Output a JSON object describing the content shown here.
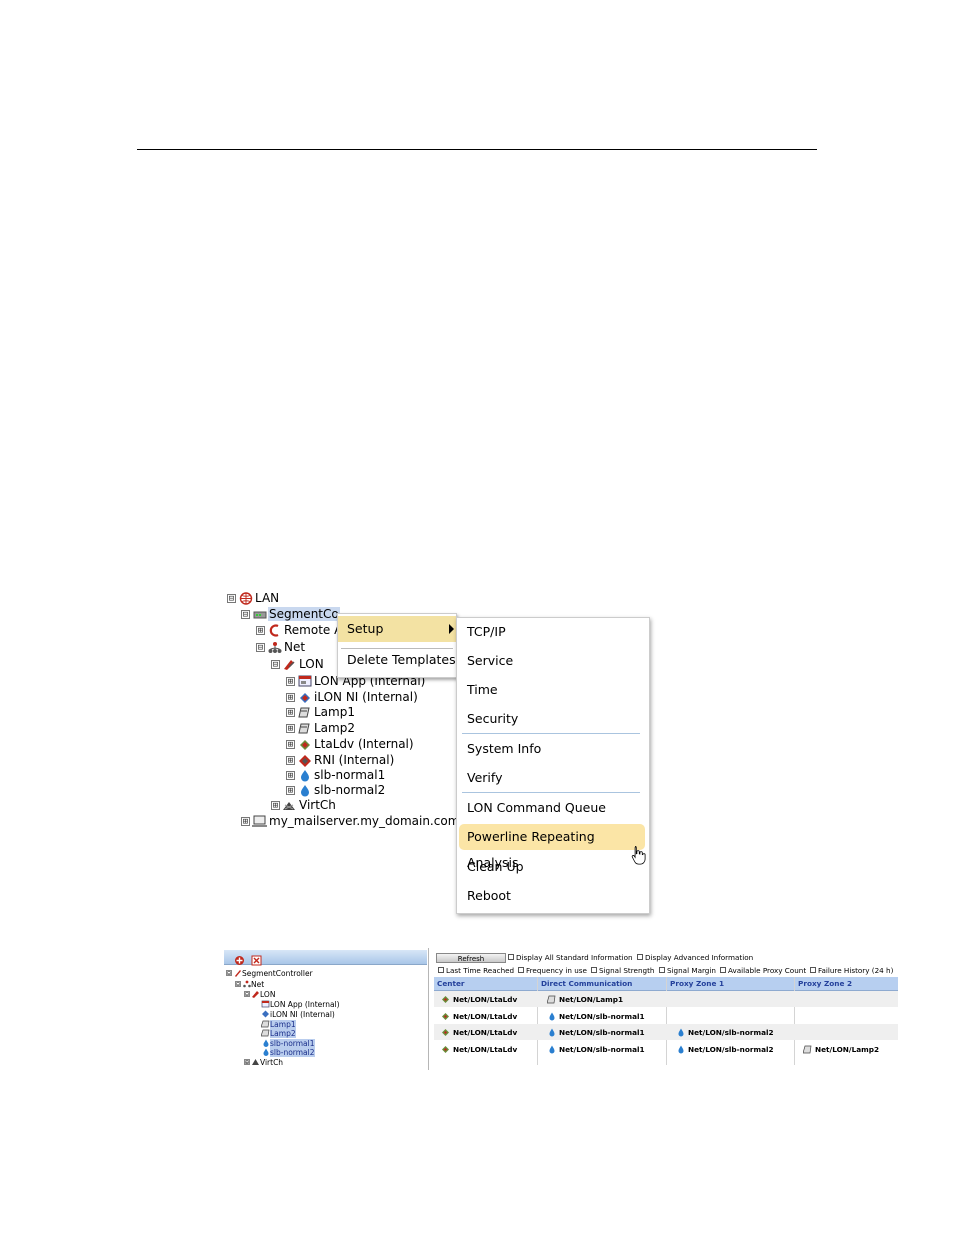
{
  "tree": {
    "items": [
      {
        "label": "LAN",
        "toggle": "⊟"
      },
      {
        "label": "SegmentCo",
        "toggle": "⊟"
      },
      {
        "label": "Remote A",
        "toggle": "⊞"
      },
      {
        "label": "Net",
        "toggle": "⊟"
      },
      {
        "label": "LON",
        "toggle": "⊟"
      },
      {
        "label": "LON App (Internal)",
        "toggle": "⊞"
      },
      {
        "label": "iLON NI (Internal)",
        "toggle": "⊞"
      },
      {
        "label": "Lamp1",
        "toggle": "⊞"
      },
      {
        "label": "Lamp2",
        "toggle": "⊞"
      },
      {
        "label": "LtaLdv (Internal)",
        "toggle": "⊞"
      },
      {
        "label": "RNI (Internal)",
        "toggle": "⊞"
      },
      {
        "label": "slb-normal1",
        "toggle": "⊞"
      },
      {
        "label": "slb-normal2",
        "toggle": "⊞"
      },
      {
        "label": "VirtCh",
        "toggle": "⊞"
      },
      {
        "label": "my_mailserver.my_domain.com",
        "toggle": "⊞"
      }
    ]
  },
  "context_menu": {
    "setup": "Setup",
    "delete_templates": "Delete Templates"
  },
  "submenu": {
    "items": [
      "TCP/IP",
      "Service",
      "Time",
      "Security",
      "System Info",
      "Verify",
      "LON Command Queue",
      "Powerline Repeating Analysis",
      "Clean Up",
      "Reboot"
    ],
    "highlighted": "Powerline Repeating Analysis"
  },
  "tree2": {
    "items": [
      {
        "label": "SegmentController",
        "toggle": "⊟"
      },
      {
        "label": "Net",
        "toggle": "⊟"
      },
      {
        "label": "LON",
        "toggle": "⊟"
      },
      {
        "label": "LON App (Internal)",
        "toggle": ""
      },
      {
        "label": "iLON NI (Internal)",
        "toggle": ""
      },
      {
        "label": "Lamp1",
        "toggle": ""
      },
      {
        "label": "Lamp2",
        "toggle": ""
      },
      {
        "label": "slb-normal1",
        "toggle": ""
      },
      {
        "label": "slb-normal2",
        "toggle": ""
      },
      {
        "label": "VirtCh",
        "toggle": "⊞"
      }
    ]
  },
  "analysis": {
    "refresh": "Refresh",
    "options_row1": [
      "Display All Standard Information",
      "Display Advanced Information"
    ],
    "options_row2": [
      "Last Time Reached",
      "Frequency in use",
      "Signal Strength",
      "Signal Margin",
      "Available Proxy Count",
      "Failure History (24 h)"
    ],
    "columns": [
      "Center",
      "Direct Communication",
      "Proxy Zone 1",
      "Proxy Zone 2"
    ],
    "rows": [
      [
        "Net/LON/LtaLdv",
        "Net/LON/Lamp1",
        "",
        ""
      ],
      [
        "Net/LON/LtaLdv",
        "Net/LON/slb-normal1",
        "",
        ""
      ],
      [
        "Net/LON/LtaLdv",
        "Net/LON/slb-normal1",
        "Net/LON/slb-normal2",
        ""
      ],
      [
        "Net/LON/LtaLdv",
        "Net/LON/slb-normal1",
        "Net/LON/slb-normal2",
        "Net/LON/Lamp2"
      ]
    ]
  },
  "colors": {
    "selection": "#c9d8ef",
    "menu_highlight": "#fbe5a6",
    "grid_header": "#b7cff0",
    "header_text": "#24419b"
  }
}
